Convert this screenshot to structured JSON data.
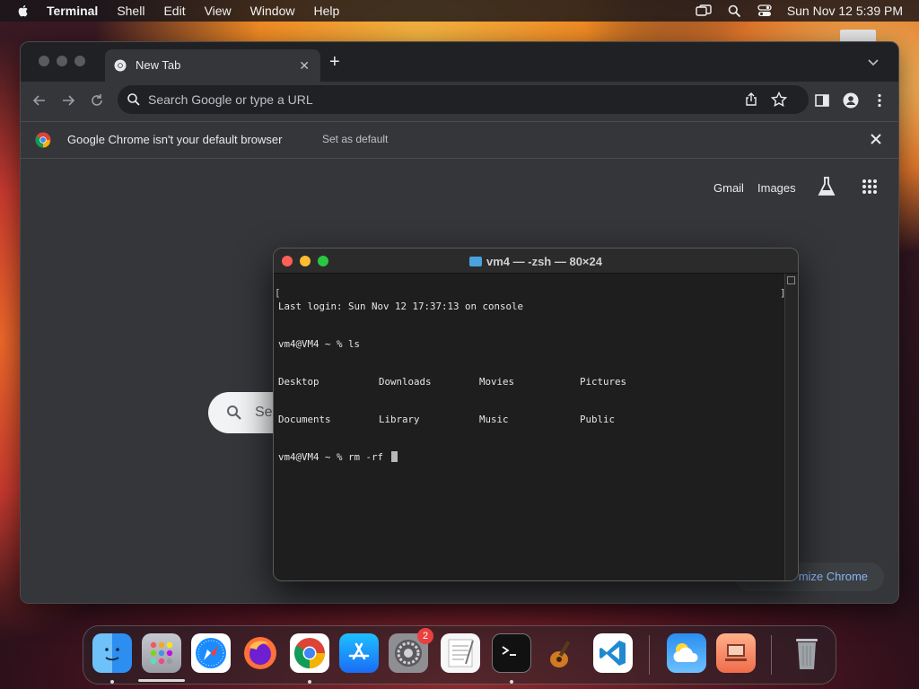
{
  "menubar": {
    "app_name": "Terminal",
    "menus": [
      "Shell",
      "Edit",
      "View",
      "Window",
      "Help"
    ],
    "clock": "Sun Nov 12  5:39 PM"
  },
  "chrome": {
    "tab": {
      "title": "New Tab"
    },
    "omnibox": {
      "placeholder": "Search Google or type a URL"
    },
    "infobar": {
      "message": "Google Chrome isn't your default browser",
      "action": "Set as default"
    },
    "ntp": {
      "gmail": "Gmail",
      "images": "Images",
      "search_partial": "Se",
      "customize_partial": "mize Chrome"
    }
  },
  "terminal": {
    "title": "vm4 — -zsh — 80×24",
    "last_login": "Last login: Sun Nov 12 17:37:13 on console",
    "prompt1": "vm4@VM4 ~ % ls",
    "ls_row1": [
      "Desktop",
      "Downloads",
      "Movies",
      "Pictures"
    ],
    "ls_row2": [
      "Documents",
      "Library",
      "Music",
      "Public"
    ],
    "prompt2": "vm4@VM4 ~ % rm -rf "
  },
  "dock": {
    "items": [
      "finder",
      "launchpad",
      "safari",
      "firefox",
      "chrome",
      "app-store",
      "system-settings",
      "textedit",
      "terminal",
      "garageband",
      "vscode",
      "weather",
      "screen-sharing",
      "trash"
    ],
    "system_settings_badge": "2"
  },
  "colors": {
    "accent_blue": "#8ab4f8",
    "terminal_bg": "#1e1e1e",
    "chrome_bg": "#35363a"
  }
}
